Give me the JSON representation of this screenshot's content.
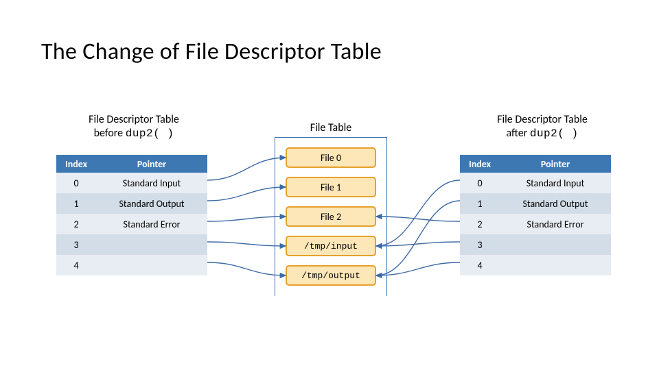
{
  "title": "The Change of File Descriptor Table",
  "captions": {
    "left_line1": "File Descriptor Table",
    "left_line2_prefix": "before ",
    "left_line2_fn": "dup2( )",
    "mid": "File Table",
    "right_line1": "File Descriptor Table",
    "right_line2_prefix": "after ",
    "right_line2_fn": "dup2( )"
  },
  "headers": {
    "index": "Index",
    "pointer": "Pointer"
  },
  "left_table": [
    {
      "index": "0",
      "pointer": "Standard Input"
    },
    {
      "index": "1",
      "pointer": "Standard Output"
    },
    {
      "index": "2",
      "pointer": "Standard Error"
    },
    {
      "index": "3",
      "pointer": ""
    },
    {
      "index": "4",
      "pointer": ""
    }
  ],
  "right_table": [
    {
      "index": "0",
      "pointer": "Standard Input"
    },
    {
      "index": "1",
      "pointer": "Standard Output"
    },
    {
      "index": "2",
      "pointer": "Standard Error"
    },
    {
      "index": "3",
      "pointer": ""
    },
    {
      "index": "4",
      "pointer": ""
    }
  ],
  "file_table": [
    "File 0",
    "File 1",
    "File 2",
    "/tmp/input",
    "/tmp/output"
  ],
  "arrows": {
    "left_to_file": [
      {
        "from_row": 0,
        "to_file": 0
      },
      {
        "from_row": 1,
        "to_file": 1
      },
      {
        "from_row": 2,
        "to_file": 2
      },
      {
        "from_row": 3,
        "to_file": 3
      },
      {
        "from_row": 4,
        "to_file": 4
      }
    ],
    "right_to_file": [
      {
        "from_row": 0,
        "to_file": 3
      },
      {
        "from_row": 1,
        "to_file": 4
      },
      {
        "from_row": 2,
        "to_file": 2
      },
      {
        "from_row": 3,
        "to_file": 3
      },
      {
        "from_row": 4,
        "to_file": 4
      }
    ]
  }
}
